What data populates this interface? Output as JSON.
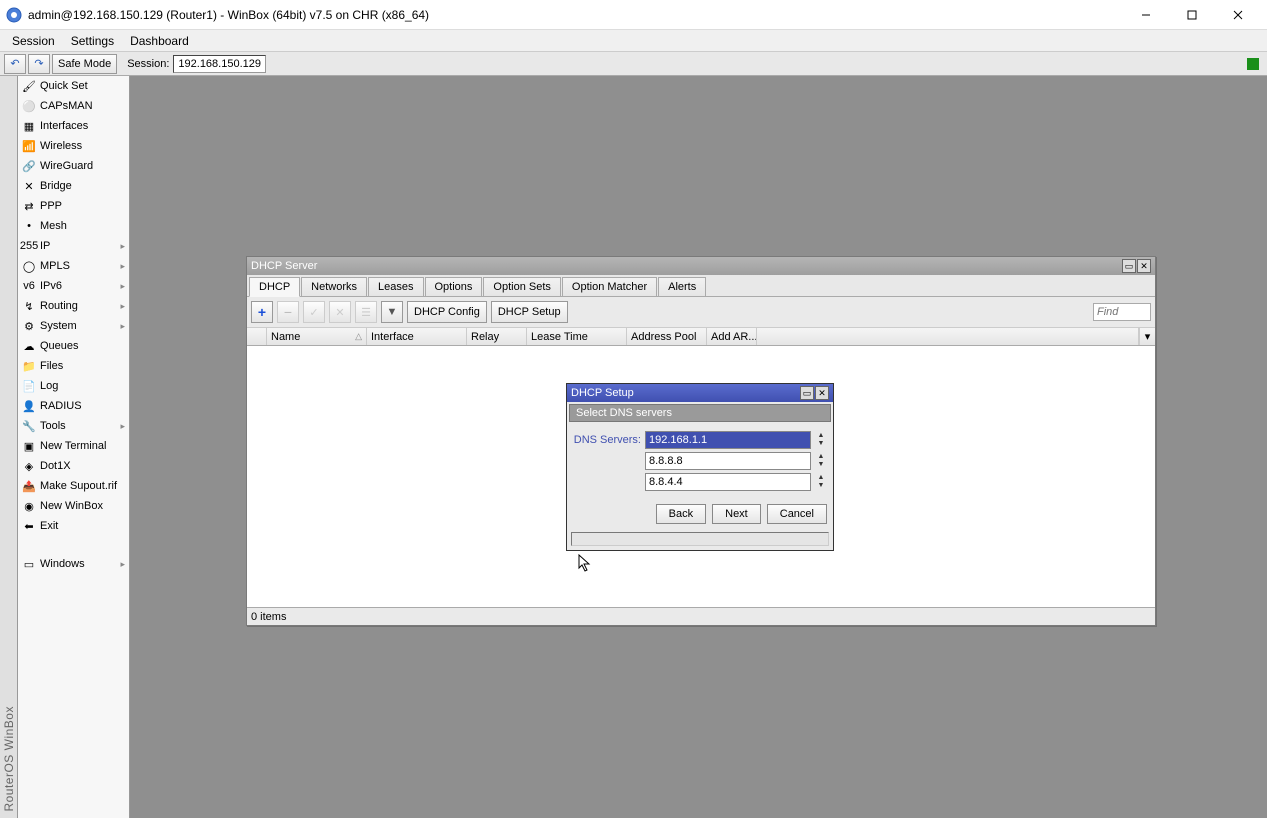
{
  "titlebar": {
    "text": "admin@192.168.150.129 (Router1) - WinBox (64bit) v7.5 on CHR (x86_64)"
  },
  "menubar": {
    "items": [
      "Session",
      "Settings",
      "Dashboard"
    ]
  },
  "toolbar": {
    "safe_mode": "Safe Mode",
    "session_label": "Session:",
    "session_value": "192.168.150.129"
  },
  "vtext": "RouterOS WinBox",
  "sidebar": {
    "items": [
      {
        "label": "Quick Set",
        "icon": "🖌",
        "chev": false
      },
      {
        "label": "CAPsMAN",
        "icon": "⚪",
        "chev": false
      },
      {
        "label": "Interfaces",
        "icon": "▦",
        "chev": false
      },
      {
        "label": "Wireless",
        "icon": "📶",
        "chev": false
      },
      {
        "label": "WireGuard",
        "icon": "🔗",
        "chev": false
      },
      {
        "label": "Bridge",
        "icon": "✕",
        "chev": false
      },
      {
        "label": "PPP",
        "icon": "⇄",
        "chev": false
      },
      {
        "label": "Mesh",
        "icon": "•",
        "chev": false
      },
      {
        "label": "IP",
        "icon": "255",
        "chev": true
      },
      {
        "label": "MPLS",
        "icon": "◯",
        "chev": true
      },
      {
        "label": "IPv6",
        "icon": "v6",
        "chev": true
      },
      {
        "label": "Routing",
        "icon": "↯",
        "chev": true
      },
      {
        "label": "System",
        "icon": "⚙",
        "chev": true
      },
      {
        "label": "Queues",
        "icon": "☁",
        "chev": false
      },
      {
        "label": "Files",
        "icon": "📁",
        "chev": false
      },
      {
        "label": "Log",
        "icon": "📄",
        "chev": false
      },
      {
        "label": "RADIUS",
        "icon": "👤",
        "chev": false
      },
      {
        "label": "Tools",
        "icon": "🔧",
        "chev": true
      },
      {
        "label": "New Terminal",
        "icon": "▣",
        "chev": false
      },
      {
        "label": "Dot1X",
        "icon": "◈",
        "chev": false
      },
      {
        "label": "Make Supout.rif",
        "icon": "📤",
        "chev": false
      },
      {
        "label": "New WinBox",
        "icon": "◉",
        "chev": false
      },
      {
        "label": "Exit",
        "icon": "⬅",
        "chev": false
      }
    ],
    "bottom_item": {
      "label": "Windows",
      "icon": "▭",
      "chev": true
    }
  },
  "dhcp_window": {
    "title": "DHCP Server",
    "tabs": [
      "DHCP",
      "Networks",
      "Leases",
      "Options",
      "Option Sets",
      "Option Matcher",
      "Alerts"
    ],
    "active_tab_index": 0,
    "buttons": {
      "config": "DHCP Config",
      "setup": "DHCP Setup"
    },
    "find_placeholder": "Find",
    "columns": [
      "",
      "Name",
      "Interface",
      "Relay",
      "Lease Time",
      "Address Pool",
      "Add AR..."
    ],
    "status": "0 items"
  },
  "dialog": {
    "title": "DHCP Setup",
    "subheader": "Select DNS servers",
    "field_label": "DNS Servers:",
    "values": [
      "192.168.1.1",
      "8.8.8.8",
      "8.8.4.4"
    ],
    "buttons": {
      "back": "Back",
      "next": "Next",
      "cancel": "Cancel"
    }
  }
}
